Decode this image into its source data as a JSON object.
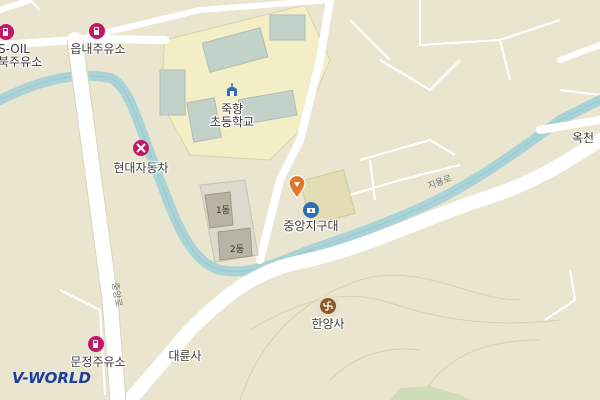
{
  "map": {
    "labels": {
      "s_oil_station": "S-OIL\n북주유소",
      "eupnae_station": "읍내주유소",
      "school": "죽향\n초등학교",
      "hyundai": "현대자동차",
      "central_district": "중앙지구대",
      "hanyangsa": "한양사",
      "daeyunsa": "대륜사",
      "munjeong_station": "문정주유소",
      "okcheon": "옥천"
    },
    "road_labels": {
      "jiyong_ro": "지용로",
      "vertical_road": "중앙로"
    },
    "buildings": {
      "b1": "1동",
      "b2": "2동"
    },
    "brand": "V-WORLD",
    "colors": {
      "background": "#eae5cf",
      "river": "#a9d3d6",
      "road": "#ffffff",
      "school_area": "#f2edc2",
      "marker": "#e0782a",
      "gas_station": "#c2186b",
      "police": "#2f6fb5",
      "temple": "#8a5a2b"
    }
  }
}
